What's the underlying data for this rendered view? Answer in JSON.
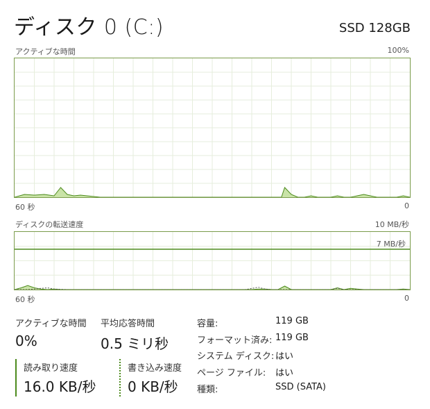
{
  "header": {
    "title": "ディスク 0 (C:)",
    "model": "SSD 128GB"
  },
  "active_graph": {
    "label": "アクティブな時間",
    "max_label": "100%",
    "left_axis": "60 秒",
    "right_axis": "0",
    "chart_data": {
      "type": "area",
      "xlabel": "",
      "ylabel": "",
      "xlim": [
        60,
        0
      ],
      "ylim": [
        0,
        100
      ],
      "x": [
        60,
        58.5,
        57,
        55.5,
        54,
        53,
        52,
        51,
        50,
        49,
        48,
        47,
        46,
        44,
        42,
        40,
        38,
        36,
        34,
        32,
        30,
        28,
        26,
        24,
        22,
        21,
        20,
        19.5,
        19,
        18,
        17,
        16,
        15,
        14,
        13,
        12,
        11,
        10,
        9,
        8,
        7,
        6,
        5,
        4,
        3,
        2,
        1,
        0
      ],
      "series": [
        {
          "values": [
            0,
            2,
            1.5,
            2,
            1,
            7,
            2,
            1,
            1.5,
            1,
            0.5,
            0,
            0,
            0,
            0,
            0,
            0,
            0,
            0,
            0,
            0,
            0,
            0,
            0,
            0,
            0,
            0,
            0,
            7,
            2,
            0,
            0,
            1,
            0,
            0,
            0,
            1,
            0,
            0,
            1,
            2,
            1,
            0,
            0,
            0,
            0,
            1,
            0
          ]
        }
      ]
    }
  },
  "transfer_graph": {
    "label": "ディスクの転送速度",
    "max_label": "10 MB/秒",
    "line_label": "7 MB/秒",
    "left_axis": "60 秒",
    "right_axis": "0",
    "chart_data": {
      "type": "area",
      "xlabel": "",
      "ylabel": "",
      "xlim": [
        60,
        0
      ],
      "ylim": [
        0,
        10
      ],
      "reference_line": 7,
      "x": [
        60,
        59,
        58,
        57,
        56,
        55,
        54,
        53,
        52,
        51,
        50,
        40,
        30,
        28,
        27,
        26,
        25,
        24,
        23,
        22,
        21,
        20,
        19,
        18,
        17,
        16,
        15,
        14,
        13,
        12,
        11,
        10,
        9,
        8,
        7,
        6,
        5,
        4,
        3,
        2,
        1,
        0
      ],
      "series": [
        {
          "name": "read",
          "style": "solid",
          "values": [
            0,
            0.3,
            0.7,
            0.3,
            0.1,
            0,
            0.1,
            0,
            0,
            0,
            0,
            0,
            0,
            0,
            0,
            0,
            0,
            0,
            0.1,
            0.1,
            0,
            0,
            0.6,
            0,
            0,
            0,
            0,
            0,
            0,
            0,
            0.3,
            0,
            0.2,
            0.1,
            0,
            0,
            0,
            0,
            0,
            0,
            0.1,
            0
          ]
        },
        {
          "name": "write",
          "style": "dashed",
          "values": [
            0,
            0,
            0,
            0.1,
            0.2,
            0.3,
            0.1,
            0.05,
            0,
            0,
            0,
            0,
            0,
            0,
            0,
            0,
            0,
            0.2,
            0.4,
            0.1,
            0,
            0,
            0,
            0,
            0,
            0,
            0,
            0,
            0,
            0,
            0.2,
            0,
            0,
            0,
            0,
            0,
            0,
            0,
            0,
            0,
            0,
            0
          ]
        }
      ]
    }
  },
  "stats": {
    "active_time": {
      "label": "アクティブな時間",
      "value": "0%"
    },
    "avg_response": {
      "label": "平均応答時間",
      "value": "0.5 ミリ秒"
    },
    "read_speed": {
      "label": "読み取り速度",
      "value": "16.0 KB/秒"
    },
    "write_speed": {
      "label": "書き込み速度",
      "value": "0 KB/秒"
    }
  },
  "info": [
    {
      "key": "容量:",
      "value": "119 GB"
    },
    {
      "key": "フォーマット済み:",
      "value": "119 GB"
    },
    {
      "key": "システム ディスク:",
      "value": "はい"
    },
    {
      "key": "ページ ファイル:",
      "value": "はい"
    },
    {
      "key": "種類:",
      "value": "SSD (SATA)"
    }
  ],
  "colors": {
    "accent": "#4c8a1c",
    "fill": "#c9e3a7",
    "grid": "#e6eedc",
    "border": "#7a9b4a"
  }
}
